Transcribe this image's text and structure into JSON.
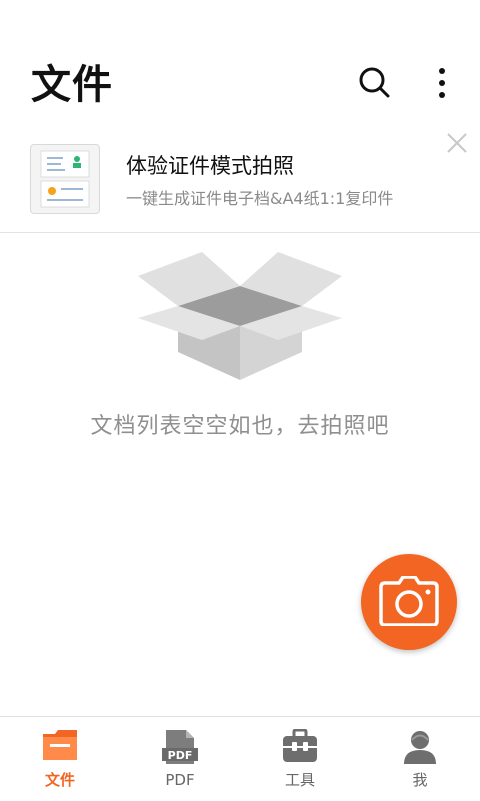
{
  "header": {
    "title": "文件"
  },
  "icons": {
    "search": "search-icon",
    "more": "more-vertical-icon",
    "close": "close-icon",
    "camera": "camera-icon"
  },
  "promo": {
    "title": "体验证件模式拍照",
    "subtitle": "一键生成证件电子档&A4纸1:1复印件"
  },
  "empty_state": {
    "message": "文档列表空空如也，去拍照吧"
  },
  "bottom_nav": {
    "items": [
      {
        "label": "文件",
        "icon": "folder-icon",
        "active": true
      },
      {
        "label": "PDF",
        "icon": "pdf-icon",
        "active": false
      },
      {
        "label": "工具",
        "icon": "toolbox-icon",
        "active": false
      },
      {
        "label": "我",
        "icon": "user-icon",
        "active": false
      }
    ]
  },
  "colors": {
    "accent": "#f26522",
    "inactive": "#666666",
    "muted_text": "#8f8f8f"
  }
}
